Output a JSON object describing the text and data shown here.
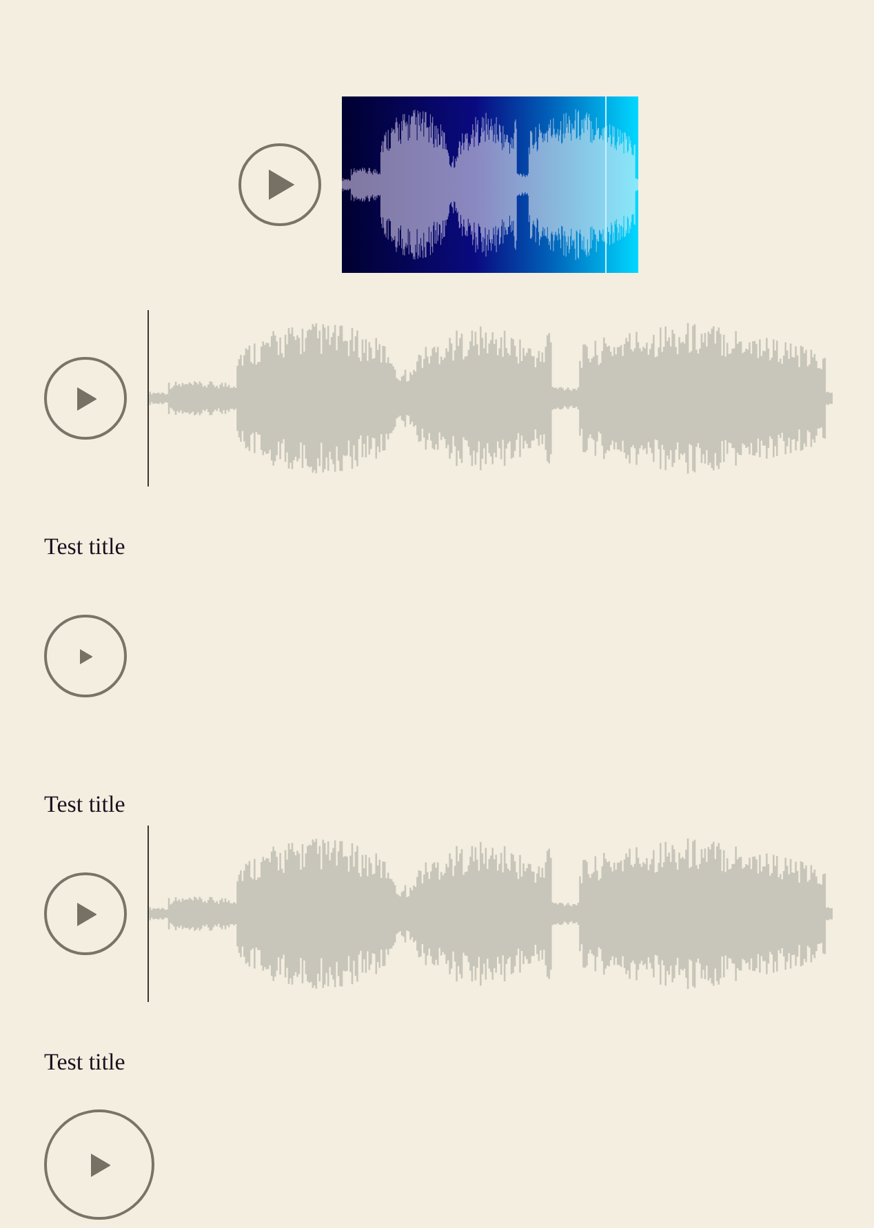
{
  "players": [
    {
      "kind": "gradient"
    },
    {
      "kind": "waveform"
    },
    {
      "kind": "button",
      "title": "Test title"
    },
    {
      "kind": "waveform",
      "title": "Test title"
    },
    {
      "kind": "large",
      "title": "Test title"
    }
  ]
}
